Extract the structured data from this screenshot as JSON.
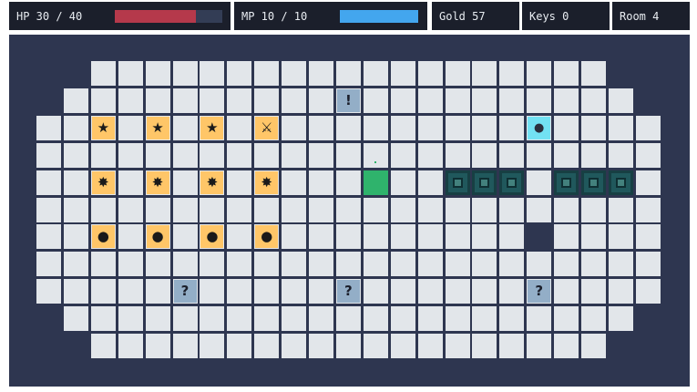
{
  "hud": {
    "hp": {
      "label": "HP 30 / 40",
      "value": 30,
      "max": 40,
      "color": "#b5394b"
    },
    "mp": {
      "label": "MP 10 / 10",
      "value": 10,
      "max": 10,
      "color": "#43a6ee"
    },
    "gold": "Gold 57",
    "keys": "Keys 0",
    "room": "Room 4"
  },
  "colors": {
    "wall": "#2e3650",
    "floor": "#e2e6ea",
    "item_bg": "#ffc668",
    "sign_bg": "#93aec7",
    "gem_bg": "#72e1f3",
    "enemy_bg": "#20585c",
    "enemy_inner": "#43817d",
    "player": "#2fb36c",
    "pit": "#2e3650"
  },
  "map": {
    "cols": 23,
    "rows": 11,
    "row_spans": [
      [
        2,
        20
      ],
      [
        1,
        21
      ],
      [
        0,
        22
      ],
      [
        0,
        22
      ],
      [
        0,
        22
      ],
      [
        0,
        22
      ],
      [
        0,
        22
      ],
      [
        0,
        22
      ],
      [
        0,
        22
      ],
      [
        1,
        21
      ],
      [
        2,
        20
      ]
    ]
  },
  "entities": [
    {
      "kind": "item",
      "icon": "star-icon",
      "glyph": "★",
      "col": 2,
      "row": 2
    },
    {
      "kind": "item",
      "icon": "star-icon",
      "glyph": "★",
      "col": 4,
      "row": 2
    },
    {
      "kind": "item",
      "icon": "star-icon",
      "glyph": "★",
      "col": 6,
      "row": 2
    },
    {
      "kind": "item",
      "icon": "crossed-swords-icon",
      "glyph": "⚔",
      "col": 8,
      "row": 2
    },
    {
      "kind": "item",
      "icon": "sparkle-icon",
      "glyph": "✸",
      "col": 2,
      "row": 4
    },
    {
      "kind": "item",
      "icon": "sparkle-icon",
      "glyph": "✸",
      "col": 4,
      "row": 4
    },
    {
      "kind": "item",
      "icon": "sparkle-icon",
      "glyph": "✸",
      "col": 6,
      "row": 4
    },
    {
      "kind": "item",
      "icon": "sparkle-icon",
      "glyph": "✸",
      "col": 8,
      "row": 4
    },
    {
      "kind": "item",
      "icon": "coin-icon",
      "glyph": "●",
      "col": 2,
      "row": 6
    },
    {
      "kind": "item",
      "icon": "coin-icon",
      "glyph": "●",
      "col": 4,
      "row": 6
    },
    {
      "kind": "item",
      "icon": "coin-icon",
      "glyph": "●",
      "col": 6,
      "row": 6
    },
    {
      "kind": "item",
      "icon": "coin-icon",
      "glyph": "●",
      "col": 8,
      "row": 6
    },
    {
      "kind": "sign",
      "icon": "exclamation-icon",
      "glyph": "!",
      "col": 11,
      "row": 1
    },
    {
      "kind": "sign",
      "icon": "question-icon",
      "glyph": "?",
      "col": 5,
      "row": 8
    },
    {
      "kind": "sign",
      "icon": "question-icon",
      "glyph": "?",
      "col": 11,
      "row": 8
    },
    {
      "kind": "sign",
      "icon": "question-icon",
      "glyph": "?",
      "col": 18,
      "row": 8
    },
    {
      "kind": "gem",
      "icon": "gem-icon",
      "glyph": "●",
      "col": 18,
      "row": 2
    },
    {
      "kind": "player",
      "icon": "player-icon",
      "glyph": "",
      "col": 12,
      "row": 4
    },
    {
      "kind": "enemy",
      "icon": "enemy-block-icon",
      "glyph": "",
      "col": 15,
      "row": 4
    },
    {
      "kind": "enemy",
      "icon": "enemy-block-icon",
      "glyph": "",
      "col": 16,
      "row": 4
    },
    {
      "kind": "enemy",
      "icon": "enemy-block-icon",
      "glyph": "",
      "col": 17,
      "row": 4
    },
    {
      "kind": "enemy",
      "icon": "enemy-block-icon",
      "glyph": "",
      "col": 19,
      "row": 4
    },
    {
      "kind": "enemy",
      "icon": "enemy-block-icon",
      "glyph": "",
      "col": 20,
      "row": 4
    },
    {
      "kind": "enemy",
      "icon": "enemy-block-icon",
      "glyph": "",
      "col": 21,
      "row": 4
    },
    {
      "kind": "pit",
      "icon": "pit-icon",
      "glyph": "",
      "col": 18,
      "row": 6
    }
  ]
}
